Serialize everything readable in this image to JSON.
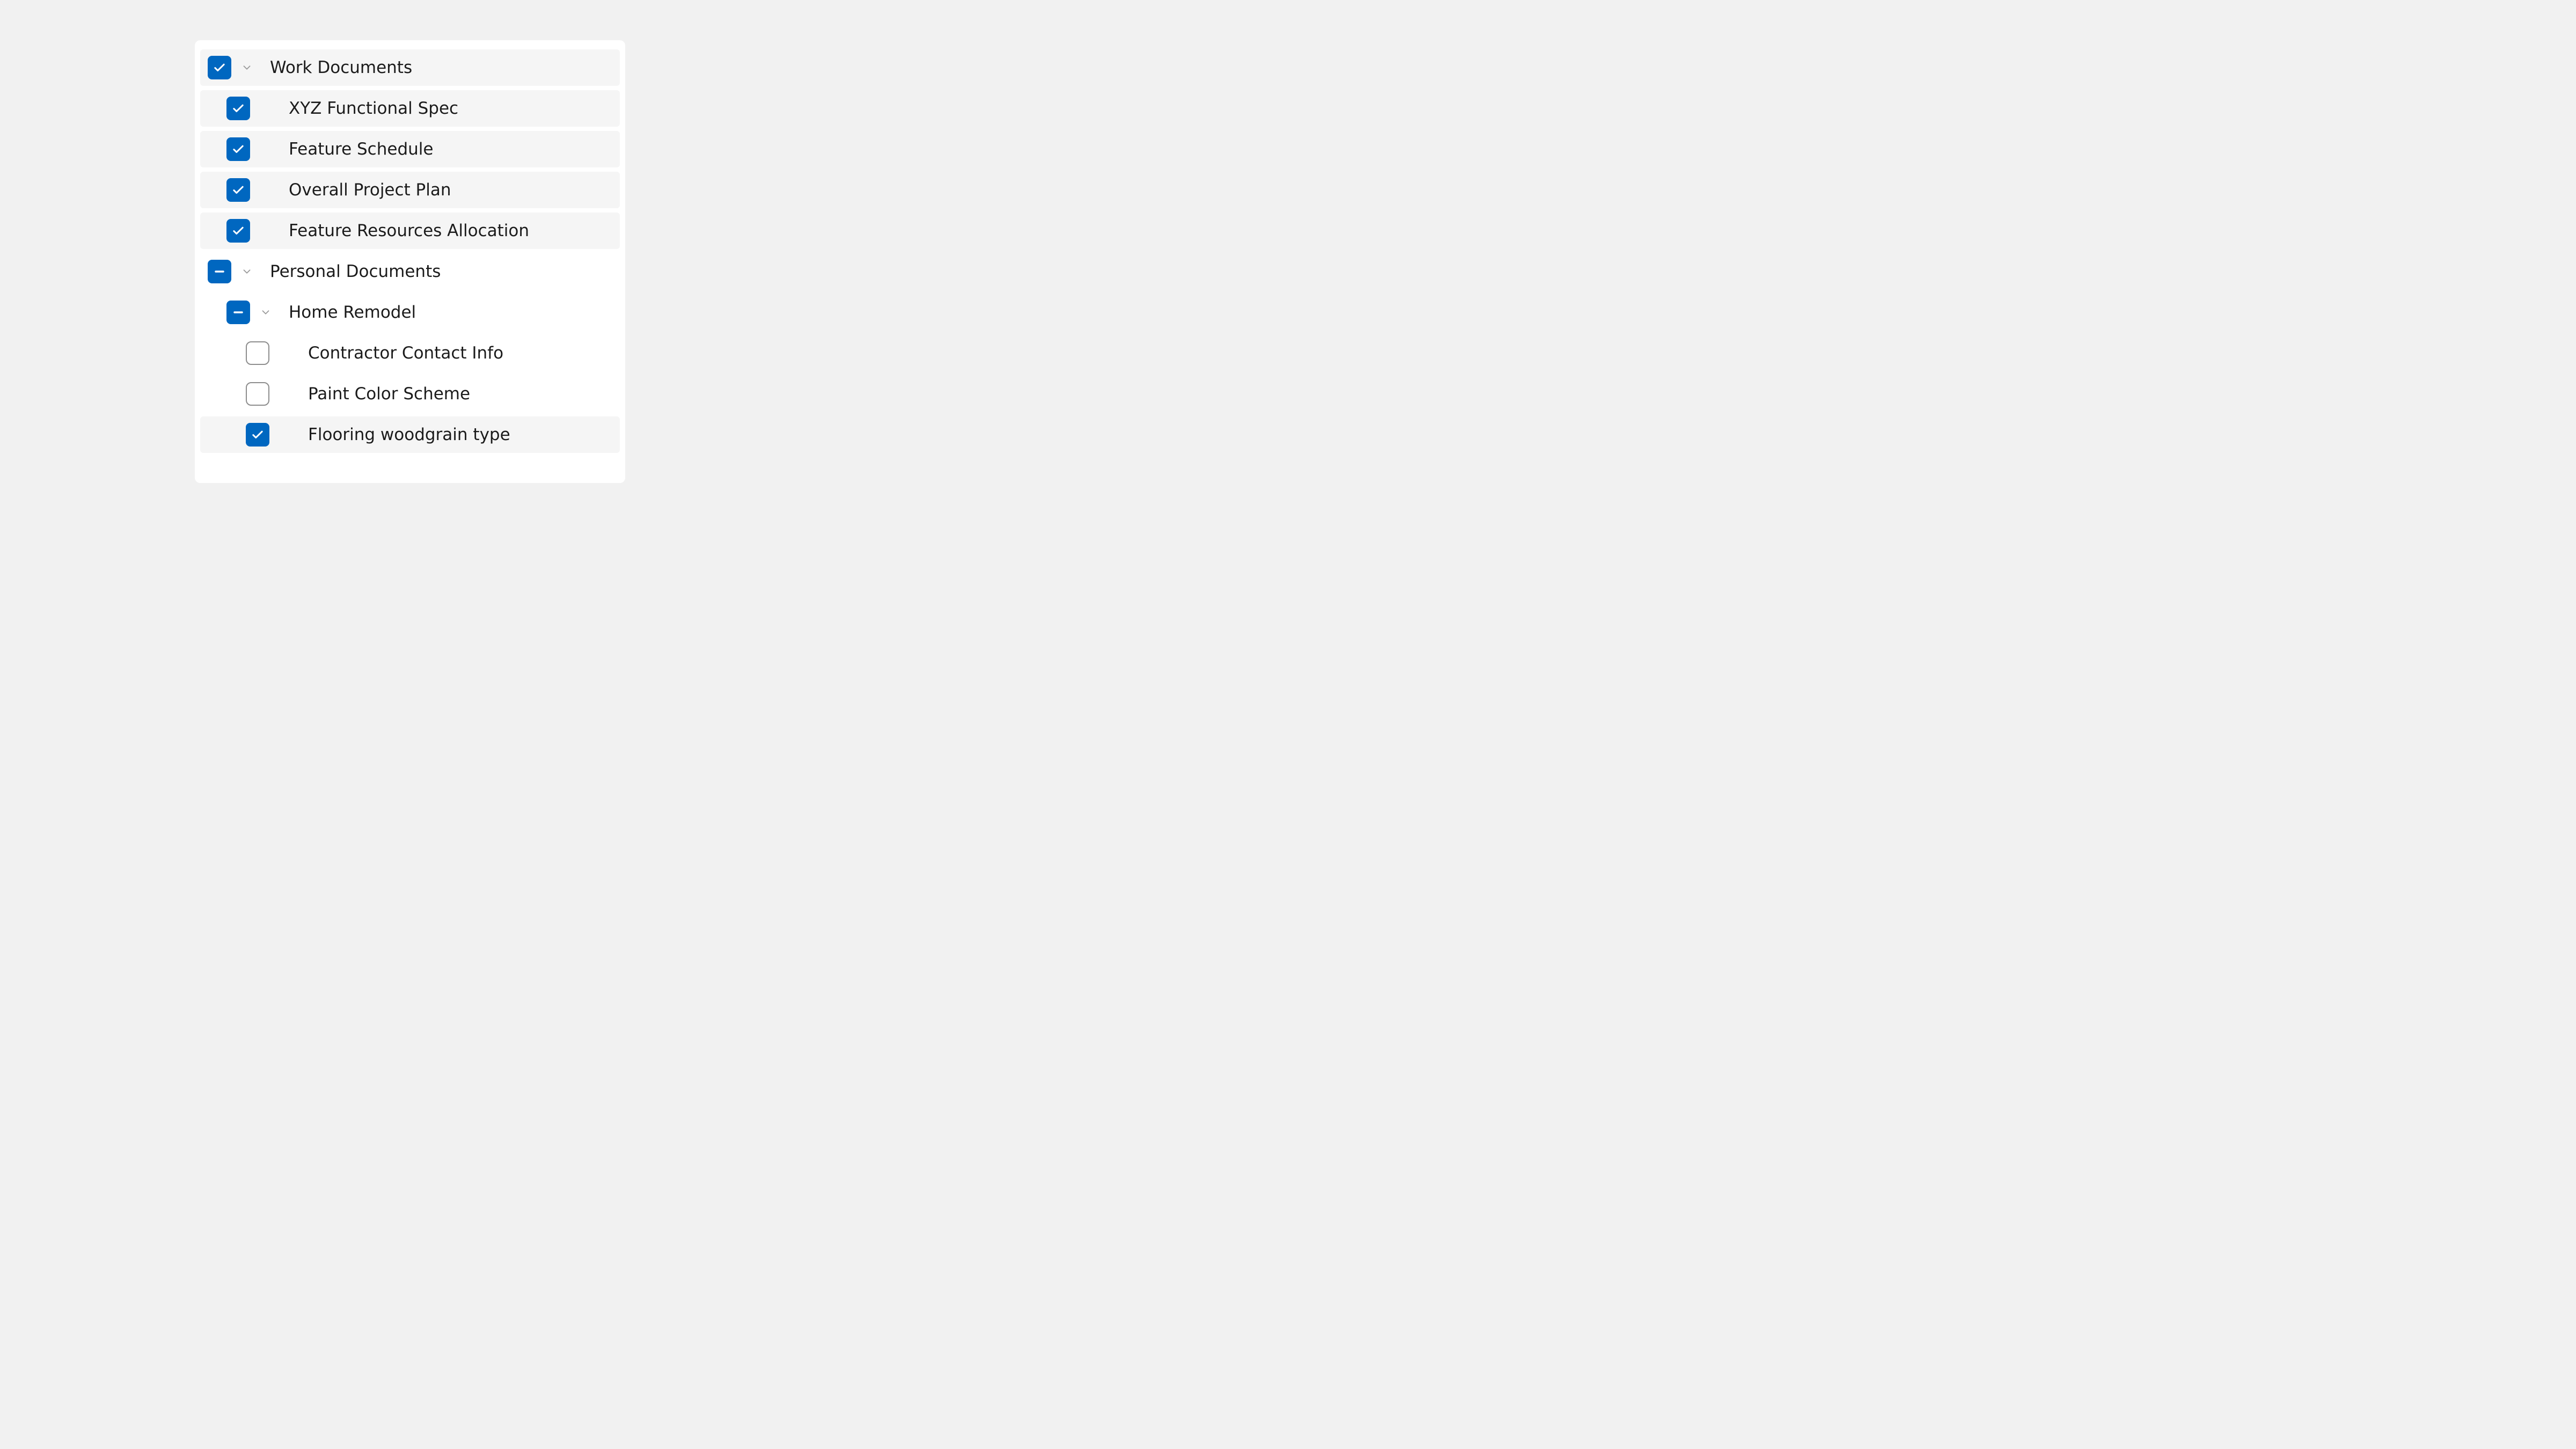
{
  "colors": {
    "accent": "#0067c0",
    "panel_bg": "#ffffff",
    "page_bg": "#f1f1f1",
    "row_selected": "#f5f5f5",
    "text": "#1b1b1b",
    "chevron": "#9b9b9b",
    "checkbox_border": "#8d8d8d"
  },
  "tree": [
    {
      "id": "work-documents",
      "level": 0,
      "label": "Work Documents",
      "state": "checked",
      "expandable": true,
      "expanded": true,
      "selected": true,
      "children": [
        {
          "id": "xyz-functional-spec",
          "level": 1,
          "label": "XYZ Functional Spec",
          "state": "checked",
          "expandable": false,
          "selected": true
        },
        {
          "id": "feature-schedule",
          "level": 1,
          "label": "Feature Schedule",
          "state": "checked",
          "expandable": false,
          "selected": true
        },
        {
          "id": "overall-project-plan",
          "level": 1,
          "label": "Overall Project Plan",
          "state": "checked",
          "expandable": false,
          "selected": true
        },
        {
          "id": "feature-resources-allocation",
          "level": 1,
          "label": "Feature Resources Allocation",
          "state": "checked",
          "expandable": false,
          "selected": true
        }
      ]
    },
    {
      "id": "personal-documents",
      "level": 0,
      "label": "Personal Documents",
      "state": "indeterminate",
      "expandable": true,
      "expanded": true,
      "selected": false,
      "children": [
        {
          "id": "home-remodel",
          "level": 1,
          "label": "Home Remodel",
          "state": "indeterminate",
          "expandable": true,
          "expanded": true,
          "selected": false,
          "children": [
            {
              "id": "contractor-contact-info",
              "level": 2,
              "label": "Contractor Contact Info",
              "state": "unchecked",
              "expandable": false,
              "selected": false
            },
            {
              "id": "paint-color-scheme",
              "level": 2,
              "label": "Paint Color Scheme",
              "state": "unchecked",
              "expandable": false,
              "selected": false
            },
            {
              "id": "flooring-woodgrain-type",
              "level": 2,
              "label": "Flooring woodgrain type",
              "state": "checked",
              "expandable": false,
              "selected": true
            }
          ]
        }
      ]
    }
  ]
}
